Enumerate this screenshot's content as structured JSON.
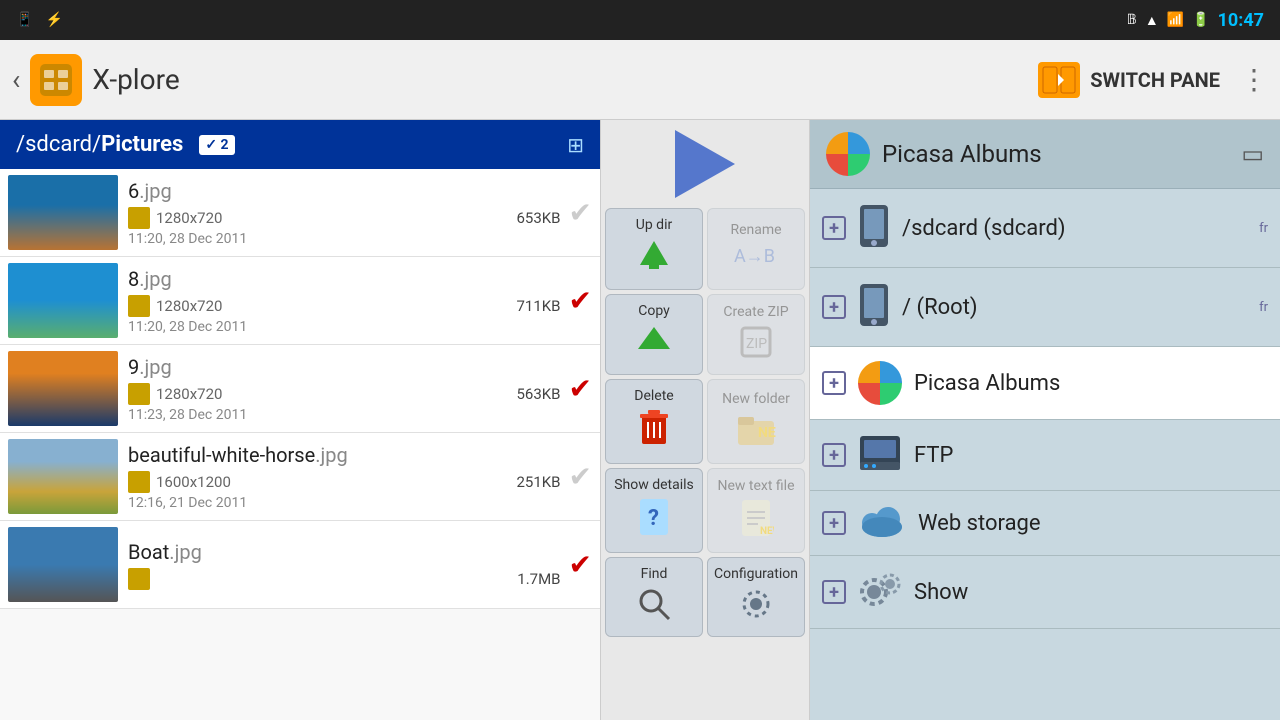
{
  "statusBar": {
    "time": "10:47",
    "icons": [
      "android",
      "usb",
      "bluetooth",
      "wifi",
      "signal",
      "battery"
    ]
  },
  "titleBar": {
    "appName": "X-plore",
    "switchPane": "SWITCH PANE",
    "backSymbol": "‹"
  },
  "leftPane": {
    "header": "/sdcard/Pictures",
    "headerBold": "Pictures",
    "checkCount": "✓ 2",
    "files": [
      {
        "name": "6",
        "ext": ".jpg",
        "dims": "1280x720",
        "size": "653KB",
        "date": "11:20, 28 Dec 2011",
        "checked": false,
        "thumbClass": "thumb-ocean"
      },
      {
        "name": "8",
        "ext": ".jpg",
        "dims": "1280x720",
        "size": "711KB",
        "date": "11:20, 28 Dec 2011",
        "checked": true,
        "thumbClass": "thumb-coast"
      },
      {
        "name": "9",
        "ext": ".jpg",
        "dims": "1280x720",
        "size": "563KB",
        "date": "11:23, 28 Dec 2011",
        "checked": true,
        "thumbClass": "thumb-sunset"
      },
      {
        "name": "beautiful-white-horse",
        "ext": ".jpg",
        "dims": "1600x1200",
        "size": "251KB",
        "date": "12:16, 21 Dec 2011",
        "checked": false,
        "thumbClass": "thumb-horse"
      },
      {
        "name": "Boat",
        "ext": ".jpg",
        "dims": "—",
        "size": "1.7MB",
        "date": "",
        "checked": true,
        "thumbClass": "thumb-boat"
      }
    ]
  },
  "centerPane": {
    "actions": [
      {
        "label": "Up dir",
        "icon": "⬆",
        "iconClass": "updir-arrow",
        "disabled": false
      },
      {
        "label": "Rename",
        "icon": "AB→",
        "iconClass": "rename-icon",
        "disabled": true
      },
      {
        "label": "Copy",
        "icon": "⧉",
        "iconClass": "copy-icon",
        "disabled": false
      },
      {
        "label": "Create ZIP",
        "icon": "🗜",
        "iconClass": "zip-icon",
        "disabled": true
      },
      {
        "label": "Delete",
        "icon": "🗑",
        "iconClass": "delete-icon",
        "disabled": false
      },
      {
        "label": "New folder",
        "icon": "📁",
        "iconClass": "newfolder-icon",
        "disabled": true
      },
      {
        "label": "Show details",
        "icon": "?",
        "iconClass": "showdetails-icon",
        "disabled": false
      },
      {
        "label": "New text file",
        "icon": "📄",
        "iconClass": "newtextfile-icon",
        "disabled": true
      },
      {
        "label": "Find",
        "icon": "🔍",
        "iconClass": "find-icon",
        "disabled": false
      },
      {
        "label": "Configuration",
        "icon": "⚙",
        "iconClass": "config-icon",
        "disabled": false
      }
    ]
  },
  "rightPane": {
    "title": "Picasa Albums",
    "locations": [
      {
        "name": "/sdcard (sdcard)",
        "type": "device",
        "sub": "fr",
        "selected": false
      },
      {
        "name": "/ (Root)",
        "type": "device",
        "sub": "fr",
        "selected": false
      },
      {
        "name": "Picasa Albums",
        "type": "picasa",
        "sub": "",
        "selected": true
      },
      {
        "name": "FTP",
        "type": "ftp",
        "sub": "",
        "selected": false
      },
      {
        "name": "Web storage",
        "type": "cloud",
        "sub": "",
        "selected": false
      },
      {
        "name": "Show",
        "type": "gear",
        "sub": "",
        "selected": false
      }
    ]
  }
}
